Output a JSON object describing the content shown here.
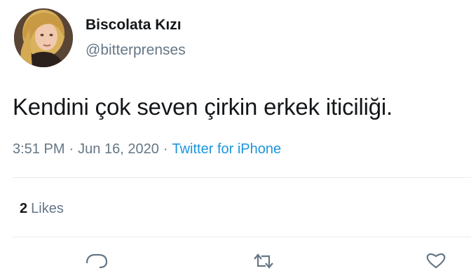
{
  "user": {
    "display_name": "Biscolata Kızı",
    "handle": "@bitterprenses",
    "avatar": "profile-photo"
  },
  "tweet": {
    "text": "Kendini çok seven çirkin erkek iticiliği.",
    "time": "3:51 PM",
    "separator": "·",
    "date": "Jun 16, 2020",
    "source": "Twitter for iPhone"
  },
  "stats": {
    "likes_count": "2",
    "likes_label": "Likes"
  },
  "actions": [
    {
      "icon": "reply-icon"
    },
    {
      "icon": "retweet-icon"
    },
    {
      "icon": "heart-icon"
    }
  ],
  "colors": {
    "text": "#14171a",
    "secondary": "#657786",
    "link": "#1b95e0",
    "divider": "#e6ecf0"
  }
}
